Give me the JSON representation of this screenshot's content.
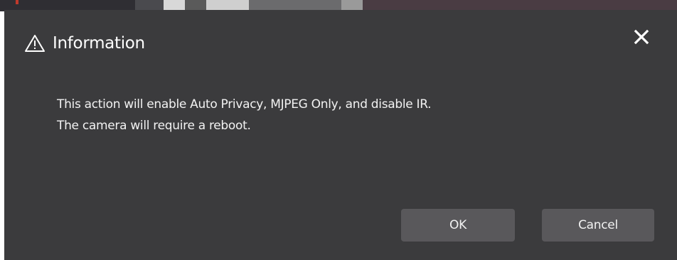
{
  "dialog": {
    "title": "Information",
    "title_icon": "warning-triangle-icon",
    "close_icon": "close-icon",
    "message_lines": [
      "This action will enable Auto Privacy, MJPEG Only, and disable IR.",
      "The camera will require a reboot."
    ],
    "buttons": {
      "ok_label": "OK",
      "cancel_label": "Cancel"
    }
  },
  "colors": {
    "dialog_background": "#3b3b3d",
    "button_background": "#59585b",
    "text": "#ffffff"
  }
}
